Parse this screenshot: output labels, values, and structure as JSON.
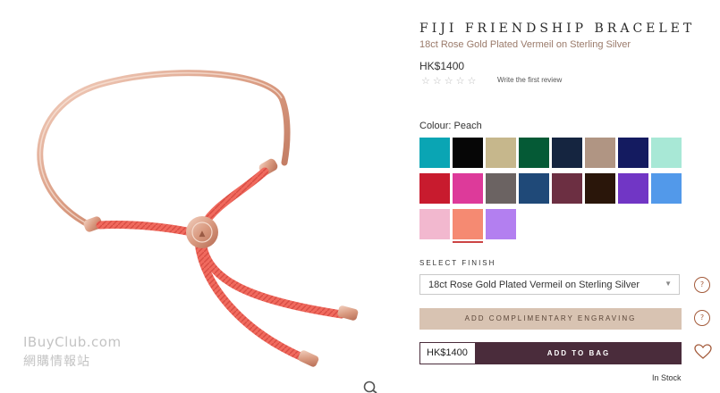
{
  "product": {
    "title": "FIJI FRIENDSHIP BRACELET",
    "subtitle": "18ct Rose Gold Plated Vermeil on Sterling Silver",
    "price": "HK$1400",
    "stars": "☆☆☆☆☆",
    "review_link": "Write the first review",
    "rating": 0
  },
  "colour": {
    "label": "Colour: Peach",
    "swatches": [
      {
        "color": "#0aa5b4"
      },
      {
        "color": "#060606"
      },
      {
        "color": "#c6b78c"
      },
      {
        "color": "#055a36"
      },
      {
        "color": "#152540"
      },
      {
        "color": "#b09583"
      },
      {
        "color": "#141b60"
      },
      {
        "color": "#a8e8d6"
      },
      {
        "color": "#c81b2e"
      },
      {
        "color": "#dd3a9a"
      },
      {
        "color": "#6b6362"
      },
      {
        "color": "#1f4978"
      },
      {
        "color": "#6c2f42"
      },
      {
        "color": "#2a160a"
      },
      {
        "color": "#7136c5"
      },
      {
        "color": "#5299ea"
      },
      {
        "color": "#f2b8cf"
      },
      {
        "color": "#f58a72",
        "selected": true
      },
      {
        "color": "#b37ff0"
      }
    ]
  },
  "finish": {
    "label": "SELECT FINISH",
    "selected": "18ct Rose Gold Plated Vermeil on Sterling Silver"
  },
  "engraving": {
    "label": "ADD COMPLIMENTARY ENGRAVING"
  },
  "cart": {
    "price": "HK$1400",
    "add_label": "ADD TO BAG"
  },
  "stock": {
    "label": "In Stock"
  },
  "watermark": {
    "line1": "IBuyClub.com",
    "line2": "網購情報站"
  },
  "icons": {
    "finish_help": "?",
    "engraving_help": "?",
    "wishlist": "heart-icon",
    "zoom": "magnifier-icon"
  },
  "colors": {
    "accent": "#4a2c3b",
    "engrave_bg": "#d8c3b2",
    "subtitle": "#9a7a6a"
  }
}
